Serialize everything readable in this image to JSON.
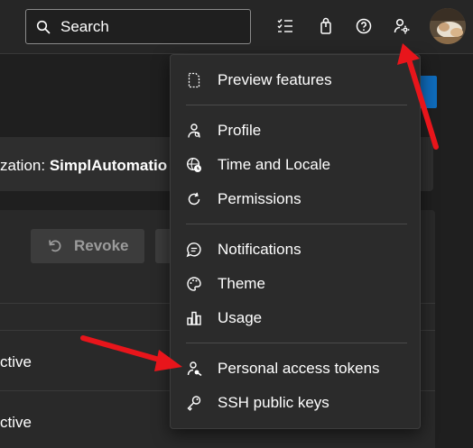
{
  "topbar": {
    "search_placeholder": "Search",
    "icons": [
      "search-icon",
      "checklist-icon",
      "shopping-bag-icon",
      "help-icon",
      "user-settings-icon"
    ]
  },
  "background": {
    "org_prefix": "zation: ",
    "org_name": "SimplAutomatio",
    "revoke_label": "Revoke",
    "rows": [
      {
        "status": "ctive"
      },
      {
        "status": "ctive"
      }
    ]
  },
  "menu": {
    "items": [
      {
        "label": "Preview features",
        "icon": "preview-document-icon"
      },
      {
        "label": "Profile",
        "icon": "profile-icon"
      },
      {
        "label": "Time and Locale",
        "icon": "globe-clock-icon"
      },
      {
        "label": "Permissions",
        "icon": "refresh-icon"
      },
      {
        "label": "Notifications",
        "icon": "chat-bubble-icon"
      },
      {
        "label": "Theme",
        "icon": "palette-icon"
      },
      {
        "label": "Usage",
        "icon": "bar-chart-icon"
      },
      {
        "label": "Personal access tokens",
        "icon": "person-key-icon"
      },
      {
        "label": "SSH public keys",
        "icon": "key-icon"
      }
    ]
  },
  "colors": {
    "accent_blue": "#0f6cbd",
    "arrow_red": "#e8151b",
    "menu_bg": "#2b2b2b",
    "topbar_bg": "#262626"
  }
}
